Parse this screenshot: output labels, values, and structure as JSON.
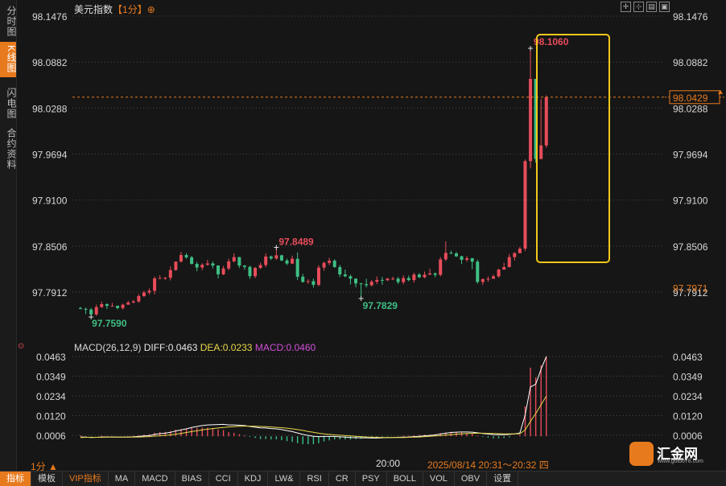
{
  "sidebar": {
    "tabs": [
      "分时图",
      "K线图",
      "闪电图",
      "合约资料"
    ],
    "active_index": 1
  },
  "header": {
    "instrument": "美元指数",
    "period_bracket": "【1分】",
    "plus_symbol": "⊕"
  },
  "toolbar": {
    "icons": [
      "crosshair-icon",
      "move-icon",
      "zoom-in-icon",
      "zoom-out-icon"
    ],
    "glyphs": [
      "✛",
      "⊹",
      "▤",
      "▣"
    ]
  },
  "chart_data": [
    {
      "type": "candlestick",
      "price_axis": {
        "ticks": [
          "98.1476",
          "98.0882",
          "98.0288",
          "97.9694",
          "97.9100",
          "97.8506",
          "97.7912"
        ],
        "tick_values": [
          98.1476,
          98.0882,
          98.0288,
          97.9694,
          97.91,
          97.8506,
          97.7912
        ]
      },
      "current_price": "98.0429",
      "right_low_label": "97.7971",
      "annotations": {
        "high_max": "98.1060",
        "high_local": "97.8489",
        "low_min": "97.7590",
        "low_local": "97.7829"
      },
      "highlight_box": true,
      "time_label": "20:00",
      "range_label": "2025/08/14 20:31～20:32 四",
      "candles": [
        [
          97.7706,
          97.7695,
          97.7721,
          97.7689
        ],
        [
          97.7695,
          97.7687,
          97.7712,
          97.7629
        ],
        [
          97.7687,
          97.7624,
          97.7707,
          97.759
        ],
        [
          97.7624,
          97.7718,
          97.7751,
          97.7606
        ],
        [
          97.7718,
          97.7756,
          97.7789,
          97.7708
        ],
        [
          97.7756,
          97.7734,
          97.7768,
          97.7693
        ],
        [
          97.7734,
          97.7734,
          97.7773,
          97.7728
        ],
        [
          97.7734,
          97.7706,
          97.774,
          97.7689
        ],
        [
          97.7706,
          97.7749,
          97.7761,
          97.7686
        ],
        [
          97.7749,
          97.7777,
          97.7799,
          97.775
        ],
        [
          97.7777,
          97.7791,
          97.7811,
          97.7767
        ],
        [
          97.7791,
          97.786,
          97.7886,
          97.7774
        ],
        [
          97.786,
          97.7907,
          97.7931,
          97.7849
        ],
        [
          97.7907,
          97.7929,
          97.7959,
          97.788
        ],
        [
          97.7929,
          97.8089,
          97.8113,
          97.7882
        ],
        [
          97.8089,
          97.8092,
          97.8131,
          97.8084
        ],
        [
          97.8092,
          97.8097,
          97.8108,
          97.8065
        ],
        [
          97.8097,
          97.8196,
          97.8246,
          97.8063
        ],
        [
          97.8196,
          97.8306,
          97.8306,
          97.8189
        ],
        [
          97.8306,
          97.839,
          97.8432,
          97.8292
        ],
        [
          97.839,
          97.8361,
          97.8415,
          97.8342
        ],
        [
          97.8361,
          97.8276,
          97.8379,
          97.8268
        ],
        [
          97.8276,
          97.8229,
          97.8302,
          97.8181
        ],
        [
          97.8229,
          97.8265,
          97.8285,
          97.8196
        ],
        [
          97.8265,
          97.8282,
          97.8327,
          97.8252
        ],
        [
          97.8282,
          97.8255,
          97.8305,
          97.8218
        ],
        [
          97.8255,
          97.8141,
          97.8259,
          97.8089
        ],
        [
          97.8141,
          97.8217,
          97.8249,
          97.8131
        ],
        [
          97.8217,
          97.8309,
          97.8344,
          97.8192
        ],
        [
          97.8309,
          97.8364,
          97.8412,
          97.8295
        ],
        [
          97.8364,
          97.8254,
          97.8366,
          97.8222
        ],
        [
          97.8254,
          97.8237,
          97.8262,
          97.82
        ],
        [
          97.8237,
          97.8117,
          97.8254,
          97.8082
        ],
        [
          97.8117,
          97.8224,
          97.8236,
          97.8093
        ],
        [
          97.8224,
          97.8261,
          97.8293,
          97.8209
        ],
        [
          97.8261,
          97.8372,
          97.8414,
          97.8233
        ],
        [
          97.8372,
          97.8346,
          97.8383,
          97.8325
        ],
        [
          97.8346,
          97.8387,
          97.8489,
          97.8329
        ],
        [
          97.8387,
          97.832,
          97.8395,
          97.8312
        ],
        [
          97.832,
          97.828,
          97.8343,
          97.8261
        ],
        [
          97.828,
          97.8342,
          97.8382,
          97.8276
        ],
        [
          97.8342,
          97.8111,
          97.8424,
          97.807
        ],
        [
          97.8111,
          97.8043,
          97.8147,
          97.8035
        ],
        [
          97.8043,
          97.8053,
          97.8078,
          97.802
        ],
        [
          97.8053,
          97.8006,
          97.8088,
          97.7971
        ],
        [
          97.8006,
          97.8228,
          97.8258,
          97.7987
        ],
        [
          97.8228,
          97.8289,
          97.8306,
          97.8188
        ],
        [
          97.8289,
          97.8318,
          97.8355,
          97.826
        ],
        [
          97.8318,
          97.8235,
          97.8336,
          97.8225
        ],
        [
          97.8235,
          97.814,
          97.8263,
          97.8107
        ],
        [
          97.814,
          97.8116,
          97.8203,
          97.8104
        ],
        [
          97.8116,
          97.8086,
          97.8137,
          97.8011
        ],
        [
          97.8086,
          97.8024,
          97.8088,
          97.7974
        ],
        [
          97.8024,
          97.8015,
          97.8031,
          97.7829
        ],
        [
          97.8015,
          97.8,
          97.8084,
          97.7972
        ],
        [
          97.8,
          97.8046,
          97.8069,
          97.7987
        ],
        [
          97.8046,
          97.8069,
          97.8114,
          97.8015
        ],
        [
          97.8069,
          97.8065,
          97.8107,
          97.8007
        ],
        [
          97.8065,
          97.8086,
          97.8095,
          97.8053
        ],
        [
          97.8086,
          97.8086,
          97.8111,
          97.8066
        ],
        [
          97.8086,
          97.8041,
          97.8109,
          97.8016
        ],
        [
          97.8041,
          97.8093,
          97.8129,
          97.8012
        ],
        [
          97.8093,
          97.8067,
          97.8125,
          97.8051
        ],
        [
          97.8067,
          97.8138,
          97.8161,
          97.8034
        ],
        [
          97.8138,
          97.8104,
          97.8158,
          97.8094
        ],
        [
          97.8104,
          97.8137,
          97.8177,
          97.809
        ],
        [
          97.8137,
          97.8153,
          97.8212,
          97.8132
        ],
        [
          97.8153,
          97.8134,
          97.8166,
          97.8103
        ],
        [
          97.8134,
          97.8334,
          97.8364,
          97.8116
        ],
        [
          97.8334,
          97.8418,
          97.8567,
          97.8313
        ],
        [
          97.8418,
          97.8411,
          97.8447,
          97.8403
        ],
        [
          97.8411,
          97.8374,
          97.8431,
          97.8365
        ],
        [
          97.8374,
          97.8329,
          97.8381,
          97.8273
        ],
        [
          97.8329,
          97.8349,
          97.8376,
          97.8303
        ],
        [
          97.8349,
          97.8305,
          97.8353,
          97.8208
        ],
        [
          97.8305,
          97.8043,
          97.8331,
          97.8021
        ],
        [
          97.8043,
          97.8079,
          97.8089,
          97.8005
        ],
        [
          97.8079,
          97.8084,
          97.8114,
          97.8044
        ],
        [
          97.8084,
          97.8115,
          97.8137,
          97.8101
        ],
        [
          97.8115,
          97.8202,
          97.8216,
          97.8098
        ],
        [
          97.8202,
          97.8235,
          97.829,
          97.8228
        ],
        [
          97.8235,
          97.8364,
          97.8405,
          97.8232
        ],
        [
          97.8364,
          97.8414,
          97.8431,
          97.8321
        ],
        [
          97.8414,
          97.8473,
          97.8496,
          97.8442
        ],
        [
          97.8473,
          97.9603,
          97.9623,
          97.8442
        ],
        [
          97.9603,
          98.0665,
          98.106,
          97.951
        ],
        [
          98.0665,
          97.9631,
          98.0661,
          97.9585
        ],
        [
          97.9631,
          97.9806,
          98.0405,
          97.9625
        ],
        [
          97.9806,
          98.0429,
          98.0452,
          97.9776
        ]
      ]
    },
    {
      "type": "line",
      "indicator": "MACD(26,12,9)",
      "legend": {
        "diff": "DIFF:0.0463",
        "dea": "DEA:0.0233",
        "macd": "MACD:0.0460"
      },
      "y_axis_ticks": [
        "0.0463",
        "0.0349",
        "0.0234",
        "0.0120",
        "0.0006"
      ],
      "y_axis_tick_values": [
        0.0463,
        0.0349,
        0.0234,
        0.012,
        0.0006
      ],
      "ylim": [
        -0.0013,
        0.0463
      ],
      "series": [
        {
          "key": "diff",
          "color": "#ffffff",
          "values": [
            -0.0004,
            -0.0005,
            -0.0007,
            -0.0006,
            -0.0004,
            -0.0004,
            -0.0004,
            -0.0005,
            -0.0005,
            -0.0004,
            -0.0003,
            -0.0001,
            0.0002,
            0.0004,
            0.0011,
            0.0015,
            0.0018,
            0.0023,
            0.0031,
            0.0037,
            0.0043,
            0.0051,
            0.0057,
            0.0062,
            0.0066,
            0.0067,
            0.0068,
            0.0069,
            0.0066,
            0.0066,
            0.0064,
            0.0062,
            0.0057,
            0.0053,
            0.0049,
            0.0048,
            0.0045,
            0.0043,
            0.0039,
            0.0033,
            0.0027,
            0.0019,
            0.0011,
            0.0005,
            0.0,
            -0.0002,
            -0.0001,
            -0.0001,
            -0.0001,
            -0.0003,
            -0.0005,
            -0.0007,
            -0.0008,
            -0.0009,
            -0.0009,
            -0.001,
            -0.001,
            -0.0009,
            -0.0008,
            -0.0007,
            -0.0006,
            -0.0005,
            -0.0004,
            -0.0002,
            0.0,
            0.0003,
            0.0005,
            0.0008,
            0.0013,
            0.0018,
            0.0022,
            0.0024,
            0.0025,
            0.0025,
            0.0024,
            0.002,
            0.0016,
            0.0013,
            0.001,
            0.0009,
            0.0009,
            0.0011,
            0.0014,
            0.0019,
            0.0124,
            0.0286,
            0.0302,
            0.0389,
            0.0463
          ]
        },
        {
          "key": "dea",
          "color": "#e8d84a",
          "values": [
            -0.0007,
            -0.0006,
            -0.0006,
            -0.0006,
            -0.0006,
            -0.0005,
            -0.0005,
            -0.0005,
            -0.0005,
            -0.0005,
            -0.0005,
            -0.0004,
            -0.0003,
            -0.0002,
            0.0001,
            0.0003,
            0.0005,
            0.0008,
            0.0012,
            0.0017,
            0.0022,
            0.0027,
            0.0032,
            0.0037,
            0.0041,
            0.0045,
            0.0048,
            0.0051,
            0.0054,
            0.0056,
            0.0058,
            0.0059,
            0.0059,
            0.0058,
            0.0057,
            0.0056,
            0.0054,
            0.0052,
            0.005,
            0.0047,
            0.0043,
            0.0039,
            0.0034,
            0.0028,
            0.0023,
            0.0018,
            0.0014,
            0.0011,
            0.0008,
            0.0006,
            0.0004,
            0.0002,
            0.0,
            -0.0002,
            -0.0004,
            -0.0005,
            -0.0006,
            -0.0007,
            -0.0007,
            -0.0007,
            -0.0007,
            -0.0007,
            -0.0006,
            -0.0005,
            -0.0004,
            -0.0002,
            0.0,
            0.0002,
            0.0004,
            0.0007,
            0.0009,
            0.0012,
            0.0014,
            0.0016,
            0.0017,
            0.0018,
            0.0018,
            0.0017,
            0.0016,
            0.0015,
            0.0014,
            0.0014,
            0.0014,
            0.0015,
            0.0037,
            0.0087,
            0.0131,
            0.0183,
            0.0233
          ]
        },
        {
          "key": "macd",
          "color": "#e05a6a",
          "values": [
            0.0006,
            0.0002,
            -0.0002,
            0.0,
            0.0004,
            0.0002,
            0.0002,
            0.0,
            0.0,
            0.0002,
            0.0004,
            0.0006,
            0.001,
            0.0012,
            0.002,
            0.0024,
            0.0026,
            0.003,
            0.0038,
            0.004,
            0.0042,
            0.0048,
            0.005,
            0.005,
            0.005,
            0.0044,
            0.004,
            0.0036,
            0.0024,
            0.002,
            0.0012,
            0.0006,
            -0.0004,
            -0.001,
            -0.0016,
            -0.0016,
            -0.0018,
            -0.0018,
            -0.0022,
            -0.0028,
            -0.0032,
            -0.004,
            -0.0046,
            -0.0046,
            -0.0046,
            -0.004,
            -0.003,
            -0.0024,
            -0.0018,
            -0.0018,
            -0.0018,
            -0.0018,
            -0.0016,
            -0.0014,
            -0.001,
            -0.001,
            -0.0008,
            -0.0004,
            -0.0002,
            0.0,
            0.0002,
            0.0004,
            0.0004,
            0.0006,
            0.0008,
            0.001,
            0.001,
            0.0012,
            0.0018,
            0.0022,
            0.0026,
            0.0024,
            0.0022,
            0.0018,
            0.0014,
            0.0004,
            -0.0004,
            -0.0008,
            -0.0012,
            -0.0012,
            -0.001,
            -0.0006,
            0.0,
            0.0008,
            0.0174,
            0.0398,
            0.0342,
            0.0412,
            0.046
          ]
        }
      ]
    }
  ],
  "footer": {
    "period_label": "1分",
    "period_arrow": "▲",
    "tabs": [
      "指标",
      "模板",
      "VIP指标",
      "MA",
      "MACD",
      "BIAS",
      "CCI",
      "KDJ",
      "LW&",
      "RSI",
      "CR",
      "PSY",
      "BOLL",
      "VOL",
      "OBV",
      "设置"
    ],
    "active_tab": 0,
    "vip_tab": 2
  },
  "logo": {
    "text": "汇金网",
    "url": "www.gold678.com"
  },
  "colors": {
    "up": "#e84c5a",
    "down": "#3fbf85",
    "accent": "#e87a1e",
    "box": "#f2c81b",
    "grid": "#4a4a4a"
  }
}
